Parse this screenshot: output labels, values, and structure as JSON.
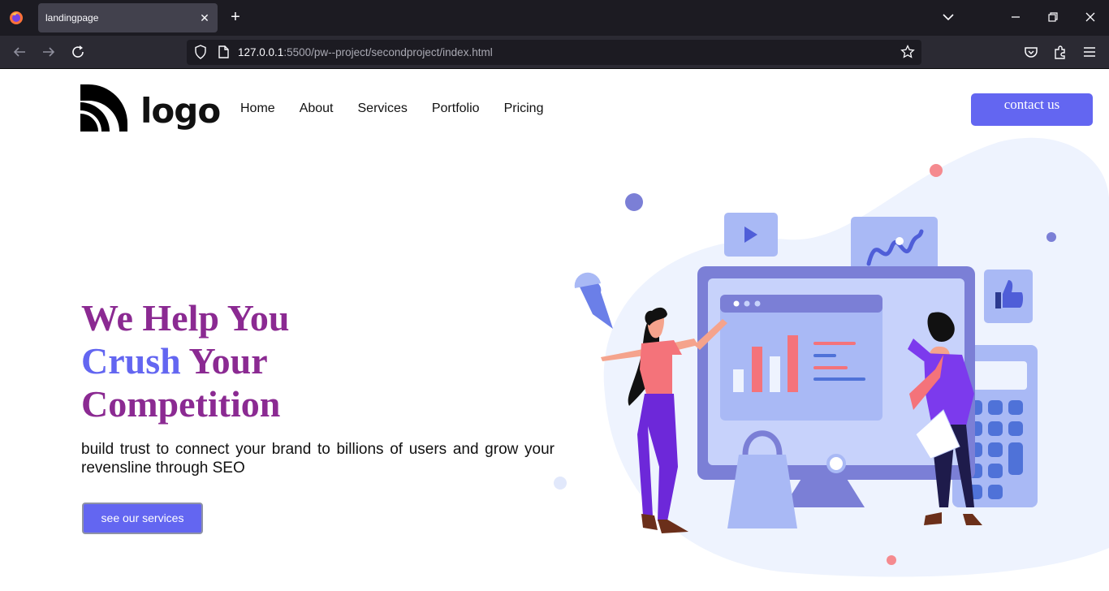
{
  "browser": {
    "tab_title": "landingpage",
    "url_host": "127.0.0.1",
    "url_rest": ":5500/pw--project/secondproject/index.html"
  },
  "site": {
    "logo_text": "logo",
    "nav": [
      "Home",
      "About",
      "Services",
      "Portfolio",
      "Pricing"
    ],
    "contact_label": "contact us"
  },
  "hero": {
    "title_line1": "We Help You",
    "title_accent": "Crush",
    "title_line2_rest": " Your",
    "title_line3": "Competition",
    "description": "build trust to connect your brand to billions of users and grow your revensline through SEO",
    "cta_label": "see our services"
  },
  "colors": {
    "brand": "#6366f1",
    "title": "#8b2a92",
    "chrome_dark": "#1c1b22",
    "chrome_mid": "#2b2a33"
  },
  "icons": [
    "firefox-icon",
    "close-icon",
    "plus-icon",
    "chevron-down-icon",
    "minimize-icon",
    "restore-icon",
    "window-close-icon",
    "back-icon",
    "forward-icon",
    "reload-icon",
    "shield-icon",
    "page-icon",
    "star-icon",
    "pocket-icon",
    "extensions-icon",
    "menu-icon"
  ]
}
